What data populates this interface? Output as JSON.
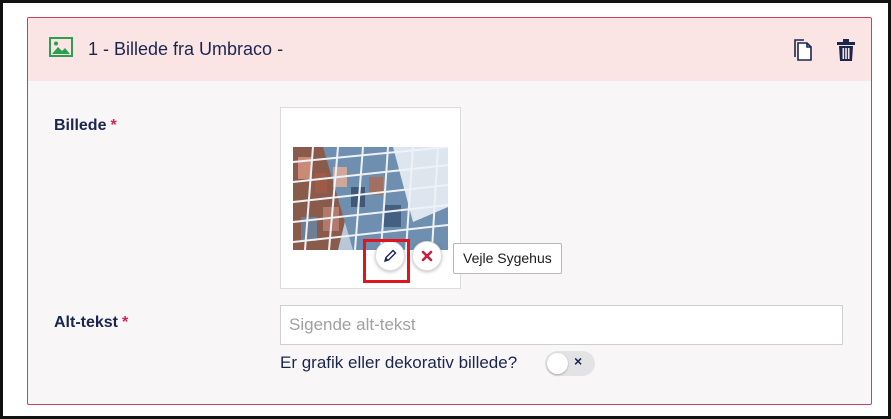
{
  "block": {
    "title": "1 - Billede fra Umbraco -",
    "header_icon": "image-icon",
    "actions": {
      "copy_icon": "copy-icon",
      "delete_icon": "trash-icon"
    }
  },
  "fields": {
    "image": {
      "label": "Billede",
      "required_mark": "*",
      "edit_icon": "pencil-icon",
      "remove_icon": "close-icon",
      "tooltip": "Vejle Sygehus"
    },
    "alt_text": {
      "label": "Alt-tekst",
      "required_mark": "*",
      "value": "",
      "placeholder": "Sigende alt-tekst"
    },
    "decorative": {
      "label": "Er grafik eller dekorativ billede?",
      "toggle_state": false,
      "toggle_icon": "×"
    }
  },
  "colors": {
    "header_bg": "#fbe4e4",
    "panel_border": "#c9405e",
    "required": "#d42054",
    "text": "#1b264f",
    "highlight": "#e0151b",
    "image_icon": "#2e9e4f"
  }
}
